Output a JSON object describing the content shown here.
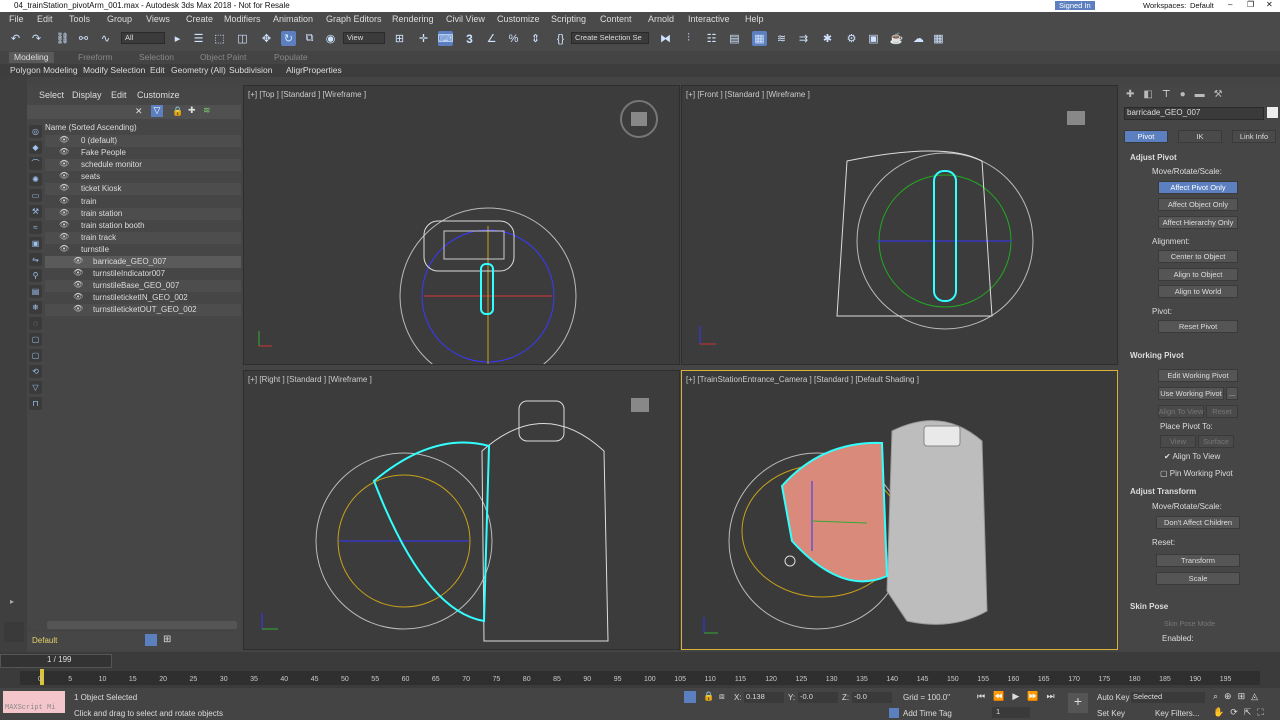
{
  "window": {
    "title": "04_trainStation_pivotArm_001.max - Autodesk 3ds Max 2018 - Not for Resale",
    "workspaces_label": "Workspaces:",
    "workspace": "Default",
    "user": "Signed In"
  },
  "menu": [
    "File",
    "Edit",
    "Tools",
    "Group",
    "Views",
    "Create",
    "Modifiers",
    "Animation",
    "Graph Editors",
    "Rendering",
    "Civil View",
    "Customize",
    "Scripting",
    "Content",
    "Arnold",
    "Interactive",
    "Help"
  ],
  "toolbar": {
    "filter": "All",
    "ref_coord": "View",
    "selection_set": "Create Selection Se",
    "snap_label": "3"
  },
  "ribbon": {
    "tabs": [
      "Modeling",
      "Freeform",
      "Selection",
      "Object Paint",
      "Populate"
    ],
    "active": "Modeling",
    "subtabs": [
      "Polygon Modeling",
      "Modify Selection",
      "Edit",
      "Geometry (All)",
      "Subdivision",
      "Align",
      "Properties"
    ]
  },
  "scene_explorer": {
    "menu": [
      "Select",
      "Display",
      "Edit",
      "Customize"
    ],
    "header": "Name (Sorted Ascending)",
    "items": [
      {
        "label": "0 (default)",
        "level": 0
      },
      {
        "label": "Fake People",
        "level": 0
      },
      {
        "label": "schedule monitor",
        "level": 0
      },
      {
        "label": "seats",
        "level": 0
      },
      {
        "label": "ticket Kiosk",
        "level": 0
      },
      {
        "label": "train",
        "level": 0
      },
      {
        "label": "train station",
        "level": 0
      },
      {
        "label": "train station booth",
        "level": 0
      },
      {
        "label": "train track",
        "level": 0
      },
      {
        "label": "turnstile",
        "level": 0
      },
      {
        "label": "barricade_GEO_007",
        "level": 1,
        "selected": true
      },
      {
        "label": "turnstileIndicator007",
        "level": 1
      },
      {
        "label": "turnstileBase_GEO_007",
        "level": 1
      },
      {
        "label": "turnstileticketIN_GEO_002",
        "level": 1
      },
      {
        "label": "turnstileticketOUT_GEO_002",
        "level": 1
      }
    ],
    "layer": "Default"
  },
  "viewports": [
    {
      "label": "[+] [Top ] [Standard ] [Wireframe ]"
    },
    {
      "label": "[+] [Front ] [Standard ] [Wireframe ]"
    },
    {
      "label": "[+] [Right ] [Standard ] [Wireframe ]"
    },
    {
      "label": "[+] [TrainStationEntrance_Camera ] [Standard ] [Default Shading ]"
    }
  ],
  "command_panel": {
    "object_name": "barricade_GEO_007",
    "tabs": [
      "Pivot",
      "IK",
      "Link Info"
    ],
    "adjust_pivot": {
      "title": "Adjust Pivot",
      "move_label": "Move/Rotate/Scale:",
      "b1": "Affect Pivot Only",
      "b2": "Affect Object Only",
      "b3": "Affect Hierarchy Only",
      "align_label": "Alignment:",
      "a1": "Center to Object",
      "a2": "Align to Object",
      "a3": "Align to World",
      "pivot_label": "Pivot:",
      "reset": "Reset Pivot"
    },
    "working_pivot": {
      "title": "Working Pivot",
      "b1": "Edit Working Pivot",
      "b2": "Use Working Pivot",
      "b2x": "...",
      "b3": "Align To View",
      "b4": "Reset",
      "place_label": "Place Pivot To:",
      "p1": "View",
      "p2": "Surface",
      "check": "Align To View",
      "pin": "Pin Working Pivot"
    },
    "adjust_transform": {
      "title": "Adjust Transform",
      "move_label": "Move/Rotate/Scale:",
      "b1": "Don't Affect Children",
      "reset_label": "Reset:",
      "r1": "Transform",
      "r2": "Scale"
    },
    "skin_pose": {
      "title": "Skin Pose",
      "mode": "Skin Pose Mode",
      "enabled": "Enabled:"
    }
  },
  "timeline": {
    "frame": "1 / 199",
    "ticks": [
      "0",
      "5",
      "10",
      "15",
      "20",
      "25",
      "30",
      "35",
      "40",
      "45",
      "50",
      "55",
      "60",
      "65",
      "70",
      "75",
      "80",
      "85",
      "90",
      "95",
      "100",
      "105",
      "110",
      "115",
      "120",
      "125",
      "130",
      "135",
      "140",
      "145",
      "150",
      "155",
      "160",
      "165",
      "170",
      "175",
      "180",
      "185",
      "190",
      "195"
    ]
  },
  "status": {
    "maxscript": "MAXScript Mi",
    "selected": "1 Object Selected",
    "hint": "Click and drag to select and rotate objects",
    "x_label": "X:",
    "x": "0.138",
    "y_label": "Y:",
    "y": "-0.0",
    "z_label": "Z:",
    "z": "-0.0",
    "grid": "Grid = 100.0\"",
    "add_time_tag": "Add Time Tag",
    "auto_key": "Auto Key",
    "set_key": "Set Key",
    "key_mode": "Selected",
    "key_filters": "Key Filters...",
    "current_frame": "1"
  }
}
